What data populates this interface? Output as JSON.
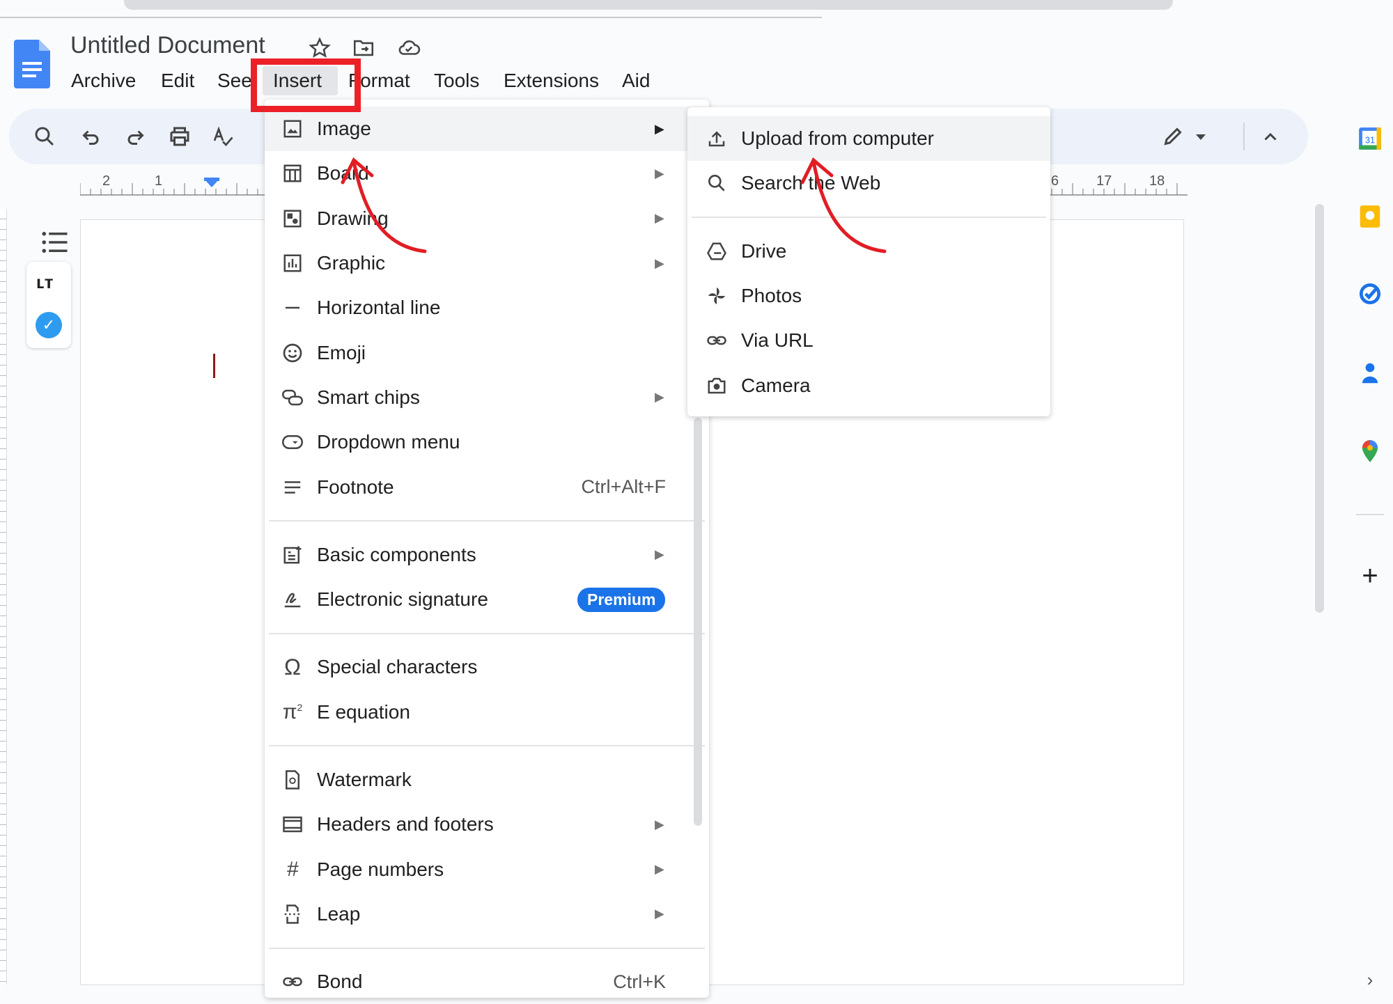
{
  "app": {
    "title": "Untitled Document"
  },
  "menubar": [
    "Archive",
    "Edit",
    "See",
    "Insert",
    "Format",
    "Tools",
    "Extensions",
    "Aid"
  ],
  "ruler": {
    "left": [
      "2",
      "1"
    ],
    "right": [
      "6",
      "17",
      "18"
    ]
  },
  "insert_menu": {
    "items": [
      {
        "label": "Image",
        "icon": "image-icon",
        "arrow": true,
        "highlighted": true
      },
      {
        "label": "Board",
        "icon": "table-icon",
        "arrow": true
      },
      {
        "label": "Drawing",
        "icon": "drawing-icon",
        "arrow": true
      },
      {
        "label": "Graphic",
        "icon": "chart-icon",
        "arrow": true
      },
      {
        "label": "Horizontal line",
        "icon": "horizontal-line-icon"
      },
      {
        "label": "Emoji",
        "icon": "emoji-icon"
      },
      {
        "label": "Smart chips",
        "icon": "smart-chips-icon",
        "arrow": true
      },
      {
        "label": "Dropdown menu",
        "icon": "dropdown-icon"
      },
      {
        "label": "Footnote",
        "icon": "footnote-icon",
        "shortcut": "Ctrl+Alt+F"
      },
      {
        "separator": true
      },
      {
        "label": "Basic components",
        "icon": "components-icon",
        "arrow": true
      },
      {
        "label": "Electronic signature",
        "icon": "signature-icon",
        "badge": "Premium"
      },
      {
        "separator": true
      },
      {
        "label": "Special characters",
        "icon": "omega-icon"
      },
      {
        "label": "E equation",
        "icon": "pi-icon"
      },
      {
        "separator": true
      },
      {
        "label": "Watermark",
        "icon": "watermark-icon"
      },
      {
        "label": "Headers and footers",
        "icon": "header-footer-icon",
        "arrow": true
      },
      {
        "label": "Page numbers",
        "icon": "hash-icon",
        "arrow": true
      },
      {
        "label": "Leap",
        "icon": "page-break-icon",
        "arrow": true
      },
      {
        "separator": true
      },
      {
        "label": "Bond",
        "icon": "link-icon",
        "shortcut": "Ctrl+K"
      }
    ]
  },
  "image_submenu": {
    "items": [
      {
        "label": "Upload from computer",
        "icon": "upload-icon",
        "highlighted": true
      },
      {
        "label": "Search the Web",
        "icon": "search-icon"
      },
      {
        "separator": true
      },
      {
        "label": "Drive",
        "icon": "drive-icon"
      },
      {
        "label": "Photos",
        "icon": "photos-icon"
      },
      {
        "label": "Via URL",
        "icon": "link-icon"
      },
      {
        "label": "Camera",
        "icon": "camera-icon"
      }
    ]
  },
  "colors": {
    "accent": "#1a73e8",
    "annotation": "#ec2027",
    "toolbar": "#edf2fa"
  }
}
